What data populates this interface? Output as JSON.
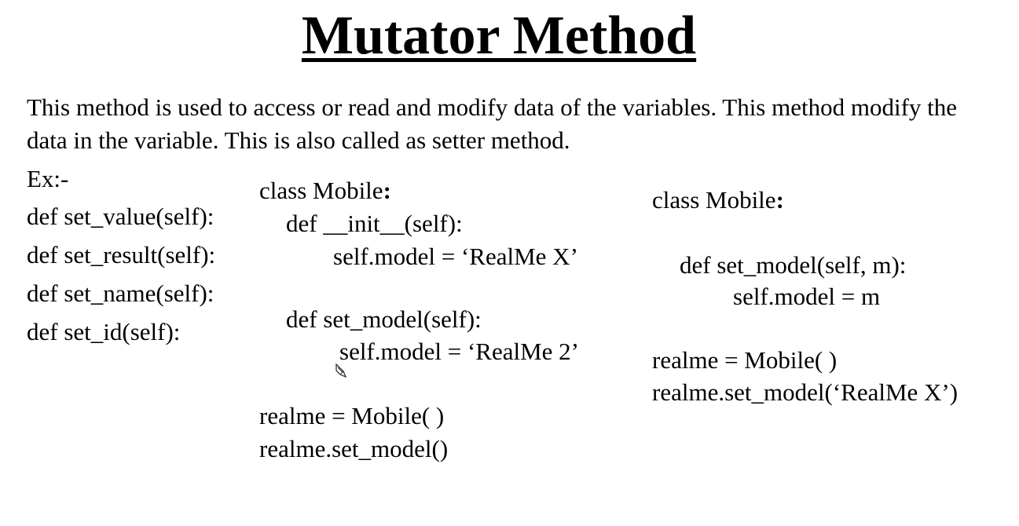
{
  "title": "Mutator Method",
  "description": "This method is used to access or read and modify data of the variables. This method modify the data in the variable. This is also called as setter method.",
  "examples": {
    "label": "Ex:-",
    "items": [
      "def set_value(self):",
      "def set_result(self):",
      "def set_name(self):",
      "def set_id(self):"
    ]
  },
  "code_middle": {
    "class_kw": "class Mobile",
    "colon": ":",
    "init_def": "def __init__(self):",
    "init_body": "self.model = ‘RealMe X’",
    "set_def": "def set_model(self):",
    "set_body": "self.model = ‘RealMe 2’",
    "instance": "realme = Mobile( )",
    "call": "realme.set_model()"
  },
  "code_right": {
    "class_kw": "class Mobile",
    "colon": ":",
    "set_def": "def set_model(self, m):",
    "set_body": "self.model = m",
    "instance": "realme = Mobile( )",
    "call": "realme.set_model(‘RealMe X’)"
  },
  "icons": {
    "cursor": "pencil-cursor-icon"
  }
}
